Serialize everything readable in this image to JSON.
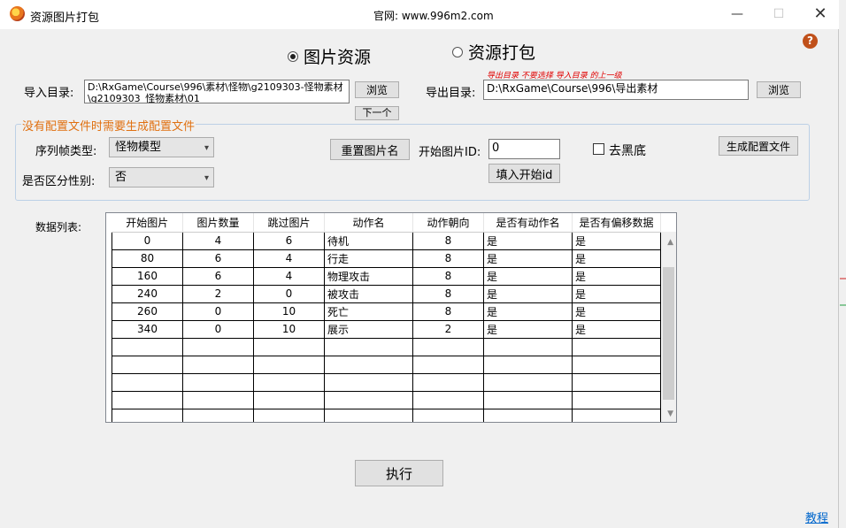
{
  "window": {
    "title": "资源图片打包",
    "website": "官网: www.996m2.com",
    "close_glyph": "✕",
    "min_glyph": "—",
    "max_glyph": "☐"
  },
  "help": {
    "glyph": "?"
  },
  "mode": {
    "option_image": "图片资源",
    "option_pack": "资源打包",
    "selected": "图片资源"
  },
  "import": {
    "label": "导入目录:",
    "value": "D:\\RxGame\\Course\\996\\素材\\怪物\\g2109303-怪物素材\\g2109303_怪物素材\\01",
    "browse": "浏览",
    "next": "下一个"
  },
  "export": {
    "note": "导出目录 不要选择 导入目录 的上一级",
    "label": "导出目录:",
    "value": "D:\\RxGame\\Course\\996\\导出素材",
    "browse": "浏览"
  },
  "config": {
    "group_title": "没有配置文件时需要生成配置文件",
    "frame_type_label": "序列帧类型:",
    "frame_type_value": "怪物模型",
    "gender_label": "是否区分性别:",
    "gender_value": "否",
    "reset_button": "重置图片名",
    "start_id_label": "开始图片ID:",
    "start_id_value": "0",
    "fill_id_button": "填入开始id",
    "remove_black_label": "去黑底",
    "remove_black_checked": false,
    "generate_button": "生成配置文件"
  },
  "data_list": {
    "label": "数据列表:",
    "columns": [
      "开始图片",
      "图片数量",
      "跳过图片",
      "动作名",
      "动作朝向",
      "是否有动作名",
      "是否有偏移数据"
    ],
    "rows": [
      [
        "0",
        "4",
        "6",
        "待机",
        "8",
        "是",
        "是"
      ],
      [
        "80",
        "6",
        "4",
        "行走",
        "8",
        "是",
        "是"
      ],
      [
        "160",
        "6",
        "4",
        "物理攻击",
        "8",
        "是",
        "是"
      ],
      [
        "240",
        "2",
        "0",
        "被攻击",
        "8",
        "是",
        "是"
      ],
      [
        "260",
        "0",
        "10",
        "死亡",
        "8",
        "是",
        "是"
      ],
      [
        "340",
        "0",
        "10",
        "展示",
        "2",
        "是",
        "是"
      ]
    ],
    "empty_rows": 5
  },
  "execute_button": "执行",
  "tutorial_link": "教程"
}
